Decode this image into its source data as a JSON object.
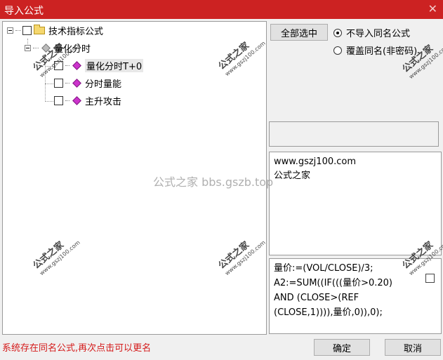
{
  "window": {
    "title": "导入公式",
    "close_icon": "close-icon"
  },
  "tree": {
    "root_label": "技术指标公式",
    "group_label": "量化分时",
    "items": [
      "量化分时T+0",
      "分时量能",
      "主升攻击"
    ]
  },
  "buttons": {
    "select_all": "全部选中",
    "ok": "确定",
    "cancel": "取消"
  },
  "import_options": {
    "no_import": "不导入同名公式",
    "overwrite": "覆盖同名(非密码)",
    "selected": "no_import"
  },
  "description": {
    "line1": "www.gszj100.com",
    "line2": "公式之家"
  },
  "code": {
    "lines": [
      "量价:=(VOL/CLOSE)/3;",
      "A2:=SUM((IF(((量价>0.20)",
      "AND (CLOSE>(REF",
      "(CLOSE,1)))),量价,0)),0);"
    ]
  },
  "status_message": "系统存在同名公式,再次点击可以更名",
  "watermark": {
    "center_text": "公式之家 bbs.gszb.top",
    "stamp_big": "公式之家",
    "stamp_small": "www.gszj100.com"
  }
}
